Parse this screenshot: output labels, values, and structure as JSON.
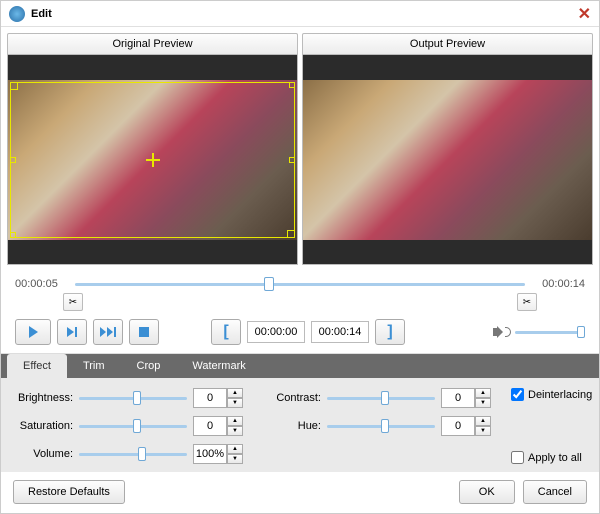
{
  "window": {
    "title": "Edit"
  },
  "previews": {
    "original": "Original Preview",
    "output": "Output Preview"
  },
  "timeline": {
    "start": "00:00:05",
    "end": "00:00:14",
    "pos_pct": 42
  },
  "trim": {
    "in": "00:00:00",
    "out": "00:00:14"
  },
  "tabs": {
    "effect": "Effect",
    "trim": "Trim",
    "crop": "Crop",
    "watermark": "Watermark",
    "active": "effect"
  },
  "effect": {
    "brightness": {
      "label": "Brightness:",
      "value": "0",
      "pct": 50
    },
    "saturation": {
      "label": "Saturation:",
      "value": "0",
      "pct": 50
    },
    "volume": {
      "label": "Volume:",
      "value": "100%",
      "pct": 55
    },
    "contrast": {
      "label": "Contrast:",
      "value": "0",
      "pct": 50
    },
    "hue": {
      "label": "Hue:",
      "value": "0",
      "pct": 50
    },
    "deinterlacing": {
      "label": "Deinterlacing",
      "checked": true
    },
    "apply_all": {
      "label": "Apply to all",
      "checked": false
    }
  },
  "footer": {
    "restore": "Restore Defaults",
    "ok": "OK",
    "cancel": "Cancel"
  }
}
